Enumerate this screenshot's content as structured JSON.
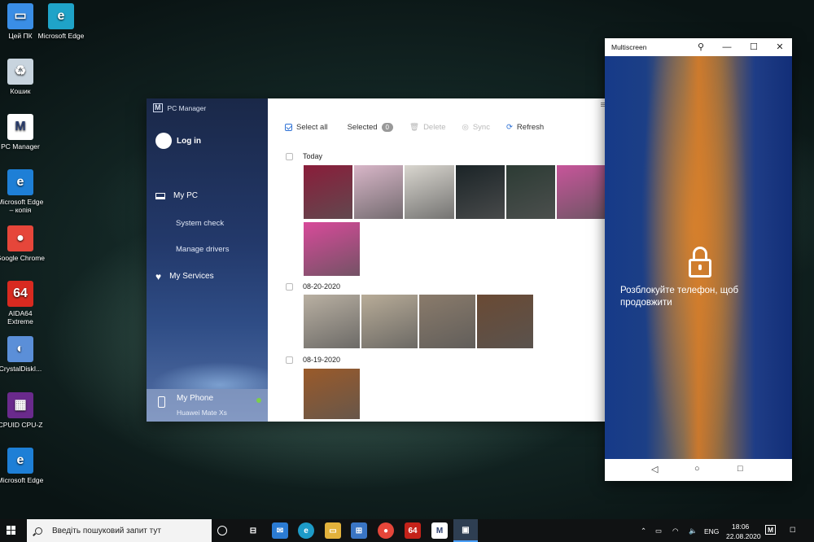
{
  "desktop": {
    "icons": [
      {
        "label": "Цей ПК",
        "icon": "this-pc-icon",
        "color": "#3a8ee6"
      },
      {
        "label": "Microsoft Edge",
        "icon": "edge-icon",
        "color": "#1fa3c8"
      },
      {
        "label": "Кошик",
        "icon": "recycle-bin-icon",
        "color": "#c8d4de"
      },
      {
        "label": "PC Manager",
        "icon": "pc-manager-icon",
        "color": "#ffffff"
      },
      {
        "label": "Microsoft Edge – копія",
        "icon": "ie-edge-icon",
        "color": "#1e7fd6"
      },
      {
        "label": "Google Chrome",
        "icon": "chrome-icon",
        "color": "#e6463a"
      },
      {
        "label": "AIDA64 Extreme",
        "icon": "aida64-icon",
        "color": "#d82a20"
      },
      {
        "label": "CrystalDiskI...",
        "icon": "crystaldisk-icon",
        "color": "#5b8fd8"
      },
      {
        "label": "CPUID CPU-Z",
        "icon": "cpuz-icon",
        "color": "#6a2a8c"
      },
      {
        "label": "Microsoft Edge",
        "icon": "ie-edge-icon",
        "color": "#1e7fd6"
      }
    ]
  },
  "pc_manager": {
    "title": "PC Manager",
    "login": "Log in",
    "nav": {
      "my_pc": "My PC",
      "system_check": "System check",
      "manage_drivers": "Manage drivers",
      "my_services": "My Services"
    },
    "phone": {
      "name": "My Phone",
      "model": "Huawei Mate Xs"
    },
    "toolbar": {
      "select_all": "Select all",
      "selected": "Selected",
      "selected_count": "0",
      "delete": "Delete",
      "sync": "Sync",
      "refresh": "Refresh"
    },
    "groups": [
      {
        "date": "Today",
        "photos": [
          "#8a1d3a",
          "#d8b6c8",
          "#d9d6cf",
          "#1b2427",
          "#2c3b34",
          "#c7559a",
          "#d84a9a"
        ]
      },
      {
        "date": "08-20-2020",
        "photos": [
          "#b9b0a2",
          "#b8ac98",
          "#8a7b6b",
          "#6a4a34"
        ]
      },
      {
        "date": "08-19-2020",
        "photos": [
          "#9a5a2a"
        ]
      }
    ]
  },
  "multiscreen": {
    "title": "Multiscreen",
    "message": "Розблокуйте телефон, щоб продовжити"
  },
  "taskbar": {
    "search_placeholder": "Введіть пошуковий запит тут",
    "lang": "ENG",
    "time": "18:06",
    "date": "22.08.2020"
  }
}
